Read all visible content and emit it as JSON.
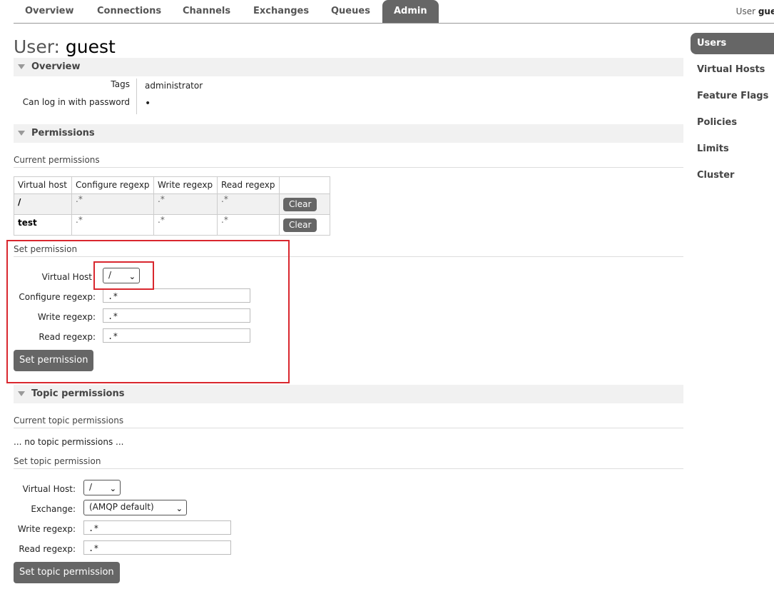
{
  "nav": {
    "tabs": [
      {
        "label": "Overview"
      },
      {
        "label": "Connections"
      },
      {
        "label": "Channels"
      },
      {
        "label": "Exchanges"
      },
      {
        "label": "Queues"
      },
      {
        "label": "Admin",
        "active": true
      }
    ],
    "user_prefix": "User",
    "user_name": "guest"
  },
  "sidebar": {
    "items": [
      {
        "label": "Users",
        "active": true
      },
      {
        "label": "Virtual Hosts"
      },
      {
        "label": "Feature Flags"
      },
      {
        "label": "Policies"
      },
      {
        "label": "Limits"
      },
      {
        "label": "Cluster"
      }
    ]
  },
  "page": {
    "title_prefix": "User:",
    "title_name": "guest"
  },
  "overview": {
    "heading": "Overview",
    "tags_label": "Tags",
    "tags_value": "administrator",
    "can_login_label": "Can log in with password",
    "can_login_value": "•"
  },
  "permissions": {
    "heading": "Permissions",
    "current_heading": "Current permissions",
    "columns": [
      "Virtual host",
      "Configure regexp",
      "Write regexp",
      "Read regexp"
    ],
    "rows": [
      {
        "vhost": "/",
        "configure": ".*",
        "write": ".*",
        "read": ".*",
        "action": "Clear"
      },
      {
        "vhost": "test",
        "configure": ".*",
        "write": ".*",
        "read": ".*",
        "action": "Clear"
      }
    ],
    "set_heading": "Set permission",
    "vhost_label": "Virtual Host",
    "vhost_value": "/",
    "configure_label": "Configure regexp:",
    "configure_value": ".*",
    "write_label": "Write regexp:",
    "write_value": ".*",
    "read_label": "Read regexp:",
    "read_value": ".*",
    "submit_label": "Set permission",
    "highlight_color": "#d9272e"
  },
  "topic_permissions": {
    "heading": "Topic permissions",
    "current_heading": "Current topic permissions",
    "empty_text": "... no topic permissions ...",
    "set_heading": "Set topic permission",
    "vhost_label": "Virtual Host:",
    "vhost_value": "/",
    "exchange_label": "Exchange:",
    "exchange_value": "(AMQP default)",
    "write_label": "Write regexp:",
    "write_value": ".*",
    "read_label": "Read regexp:",
    "read_value": ".*",
    "submit_label": "Set topic permission"
  }
}
